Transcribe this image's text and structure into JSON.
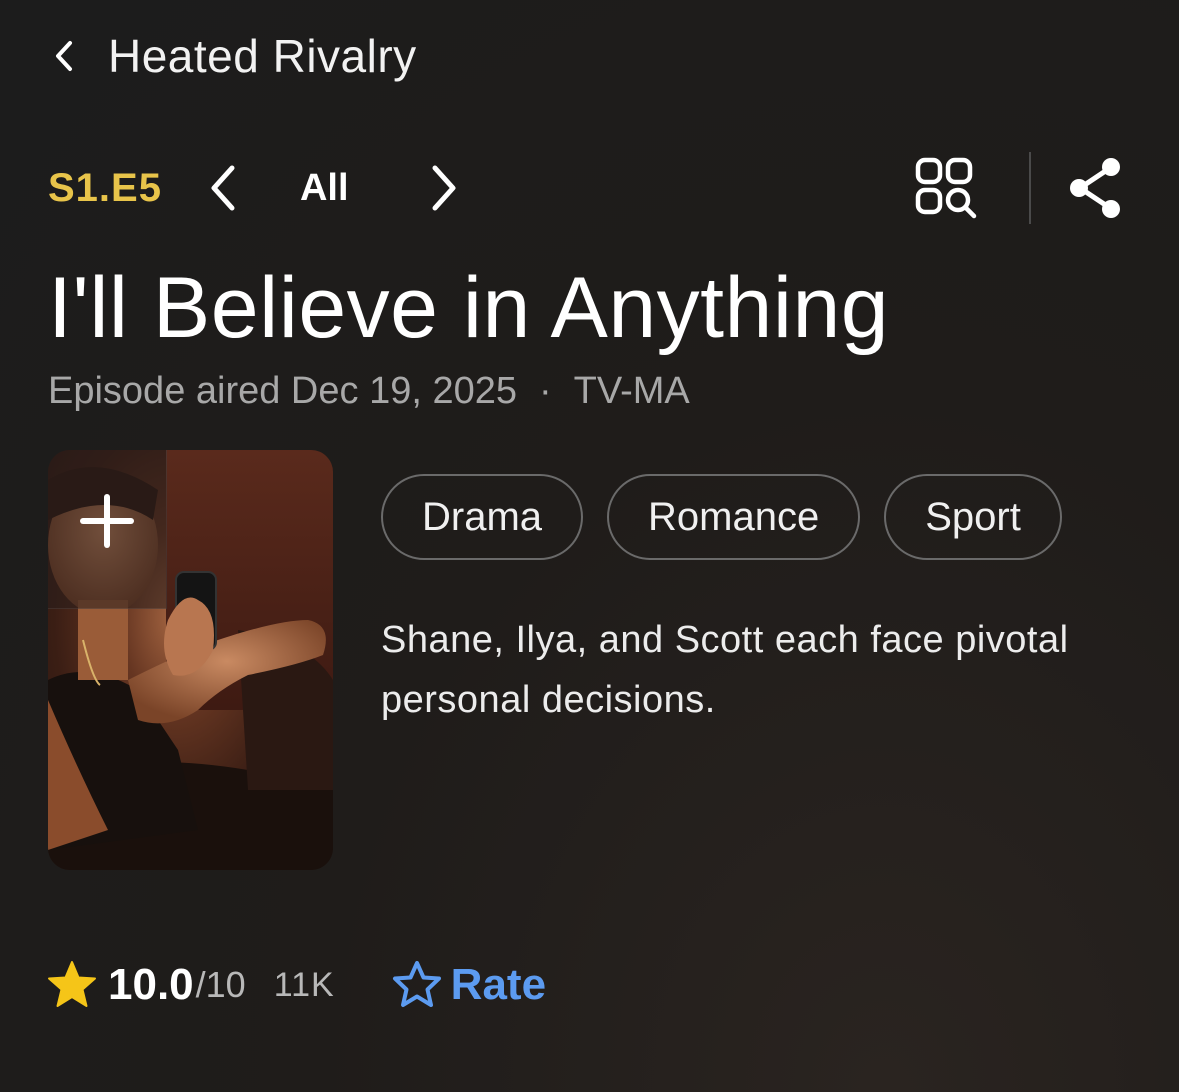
{
  "header": {
    "back_icon": "chevron-left-icon",
    "title": "Heated Rivalry"
  },
  "episode_nav": {
    "code": "S1.E5",
    "prev_icon": "chevron-left-icon",
    "all_label": "All",
    "next_icon": "chevron-right-icon",
    "grid_search_icon": "grid-search-icon",
    "share_icon": "share-icon"
  },
  "episode": {
    "title": "I'll Believe in Anything",
    "aired": "Episode aired Dec 19, 2025",
    "separator": "·",
    "rating_label": "TV-MA"
  },
  "poster": {
    "add_icon": "plus-icon"
  },
  "genres": [
    "Drama",
    "Romance",
    "Sport"
  ],
  "description": "Shane, Ilya, and Scott each face pivotal personal decisions.",
  "rating": {
    "score": "10.0",
    "max": "/10",
    "count": "11K",
    "rate_label": "Rate",
    "star_color": "#f5c518",
    "rate_color": "#5c9bf0"
  },
  "colors": {
    "episode_code": "#e8c44a",
    "background": "#1c1c1c"
  }
}
